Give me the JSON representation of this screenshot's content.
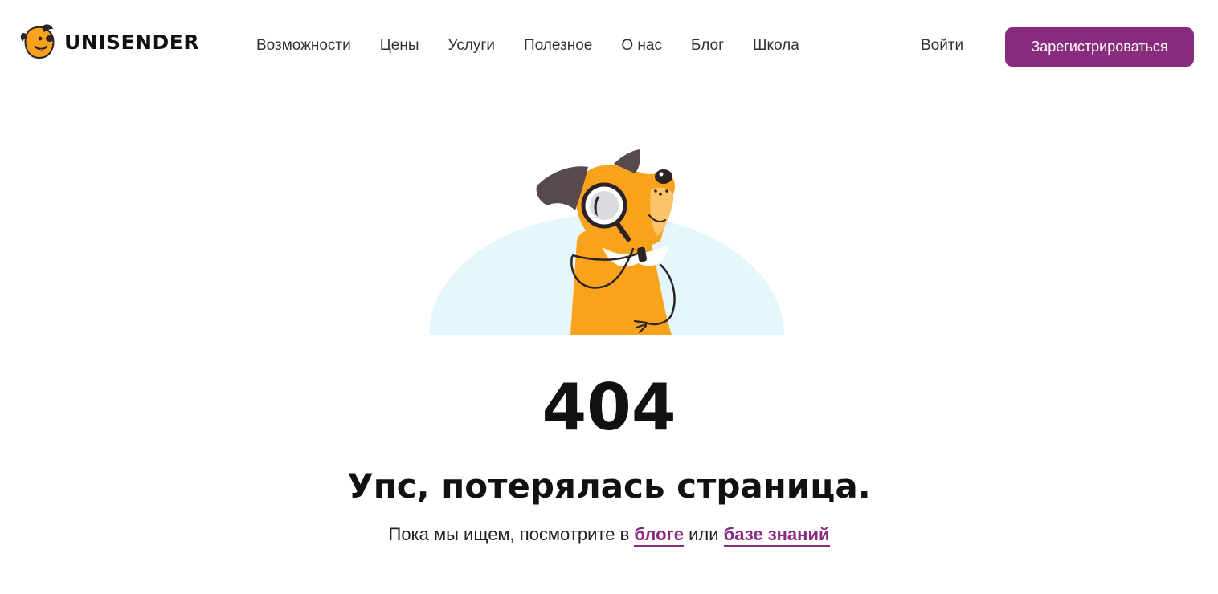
{
  "header": {
    "logo_text": "UNISENDER",
    "nav": [
      "Возможности",
      "Цены",
      "Услуги",
      "Полезное",
      "О нас",
      "Блог",
      "Школа"
    ],
    "login_label": "Войти",
    "signup_label": "Зарегистрироваться"
  },
  "error": {
    "code": "404",
    "title": "Упс, потерялась страница.",
    "text_before": "Пока мы ищем, посмотрите в ",
    "link_blog": "блоге",
    "text_middle": " или ",
    "link_kb": "базе знаний"
  },
  "colors": {
    "brand": "#892c7d",
    "dog_orange": "#f9a31c",
    "ear": "#574a4d",
    "backdrop": "#e3f7fb"
  },
  "icons": {
    "logo": "dog-head-icon",
    "illustration": "dog-with-magnifier-illustration"
  }
}
